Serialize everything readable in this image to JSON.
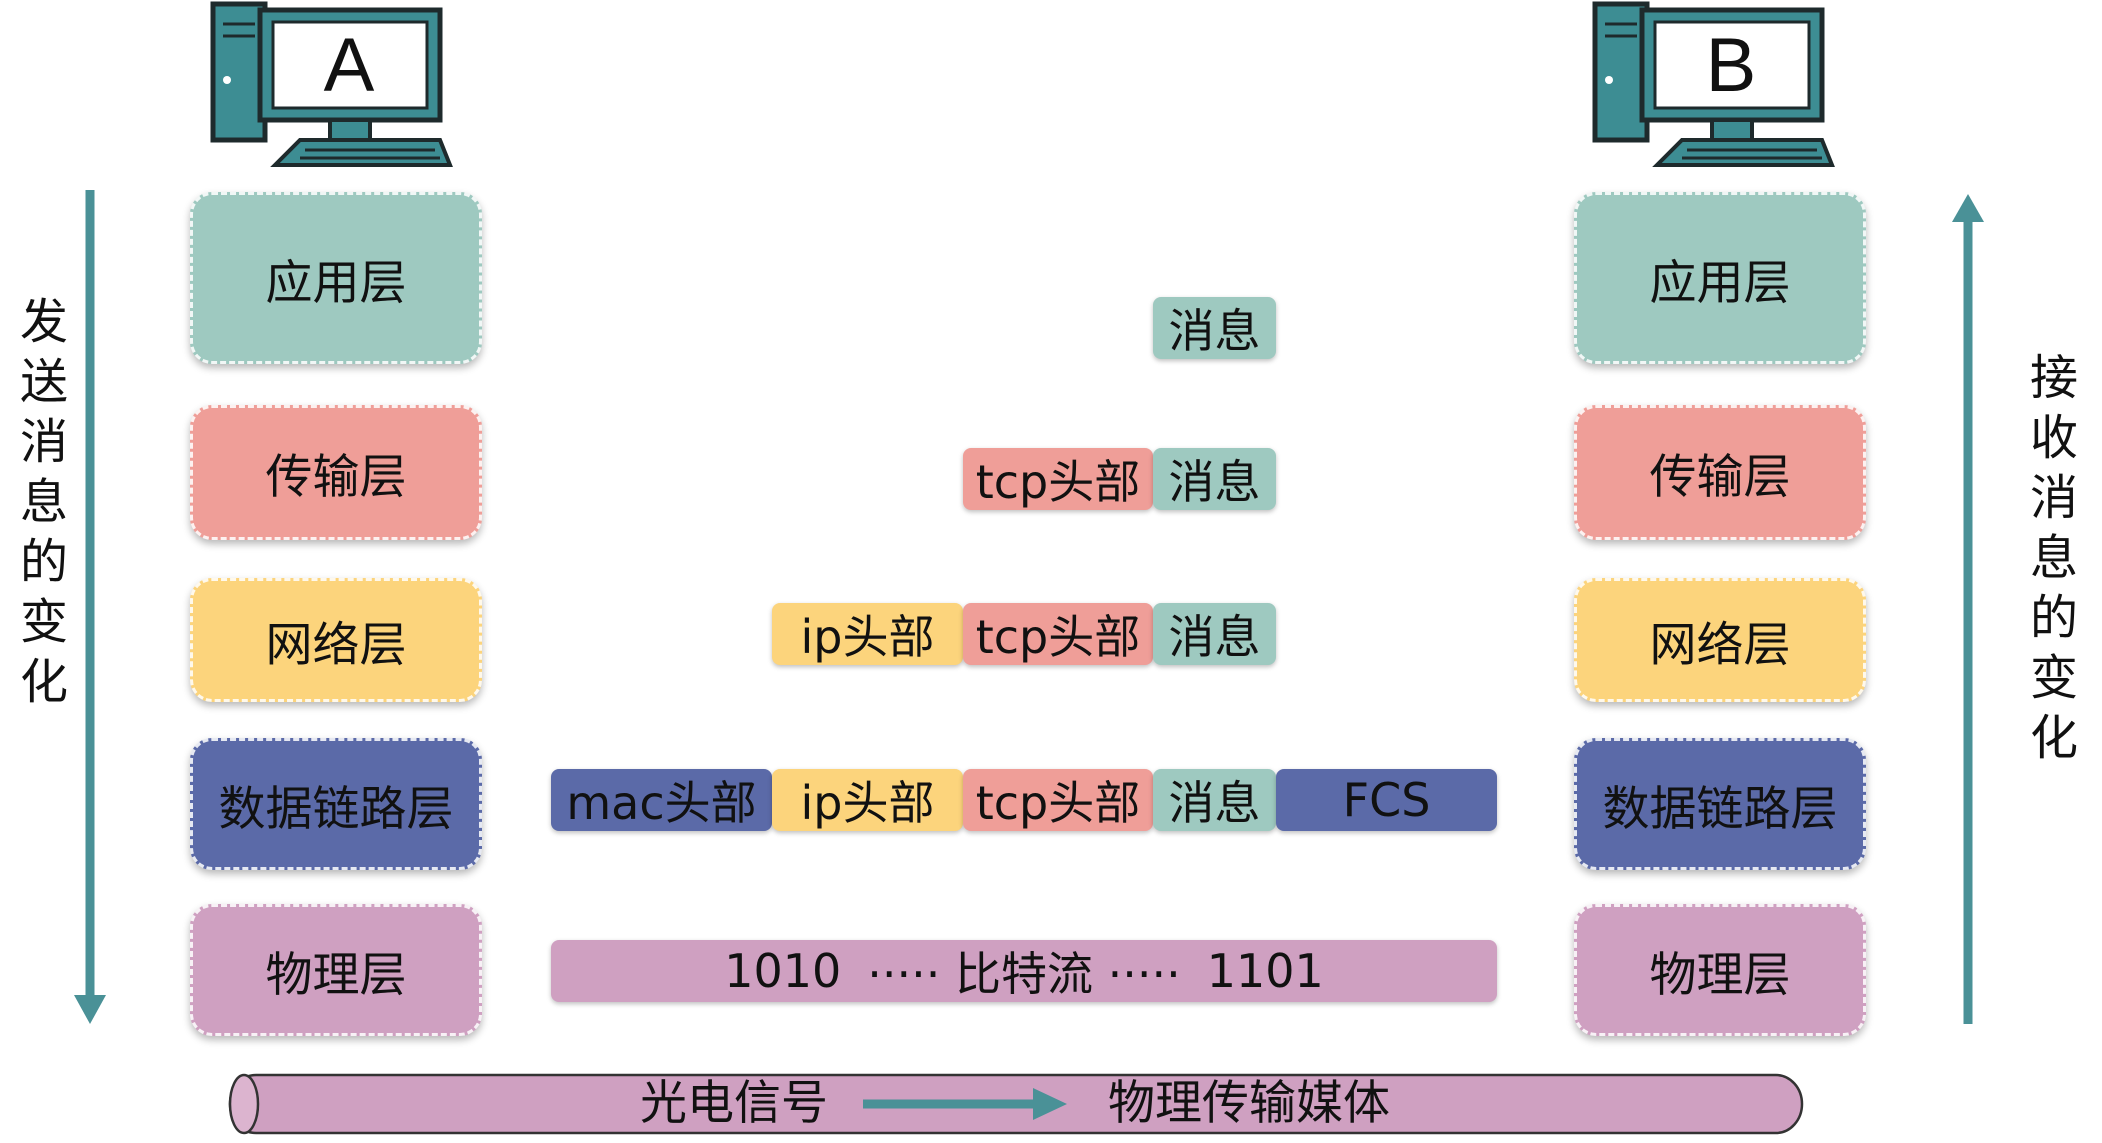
{
  "hosts": {
    "left": "A",
    "right": "B"
  },
  "layers": {
    "application": "应用层",
    "transport": "传输层",
    "network": "网络层",
    "datalink": "数据链路层",
    "physical": "物理层"
  },
  "headers": {
    "message": "消息",
    "tcp": "tcp头部",
    "ip": "ip头部",
    "mac": "mac头部",
    "fcs": "FCS"
  },
  "bitstream": {
    "start": "1010",
    "middle": "····· 比特流 ·····",
    "end": "1101"
  },
  "side_labels": {
    "send": [
      "发",
      "送",
      "消",
      "息",
      "的",
      "变",
      "化"
    ],
    "receive": [
      "接",
      "收",
      "消",
      "息",
      "的",
      "变",
      "化"
    ]
  },
  "medium": {
    "signal": "光电信号",
    "media": "物理传输媒体"
  },
  "colors": {
    "application": "#9ec9c0",
    "transport": "#ef9e98",
    "network": "#fcd47c",
    "datalink": "#5b6aa8",
    "physical": "#cfa0c1",
    "arrow": "#4a9197",
    "computer": "#3d8d93"
  }
}
